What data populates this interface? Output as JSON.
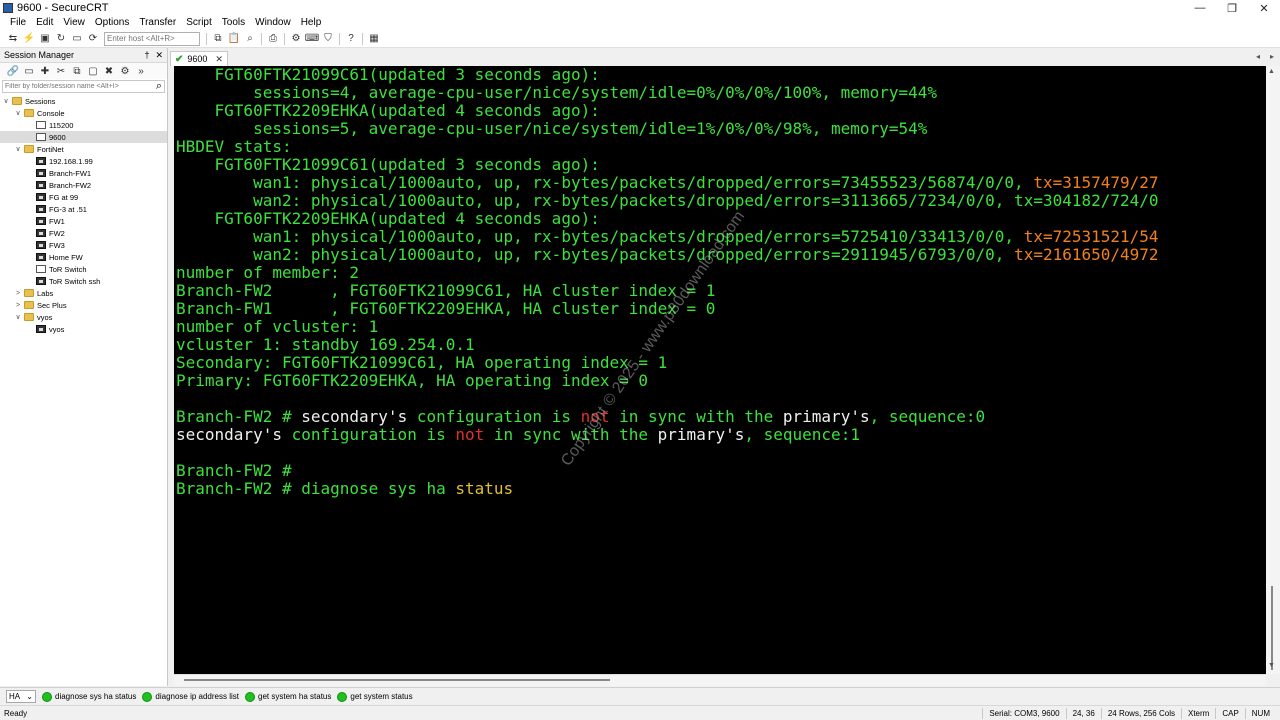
{
  "window": {
    "title": "9600 - SecureCRT",
    "controls": [
      "—",
      "❐",
      "✕"
    ]
  },
  "menu": [
    "File",
    "Edit",
    "View",
    "Options",
    "Transfer",
    "Script",
    "Tools",
    "Window",
    "Help"
  ],
  "toolbar": {
    "host_placeholder": "Enter host <Alt+R>"
  },
  "session_manager": {
    "title": "Session Manager",
    "pin": "†",
    "close": "✕",
    "filter_placeholder": "Filter by folder/session name <Alt+I>",
    "tree": [
      {
        "label": "Sessions",
        "level": 0,
        "type": "folder",
        "toggle": "∨"
      },
      {
        "label": "Console",
        "level": 1,
        "type": "folder",
        "toggle": "∨"
      },
      {
        "label": "115200",
        "level": 2,
        "type": "console"
      },
      {
        "label": "9600",
        "level": 2,
        "type": "console",
        "selected": true
      },
      {
        "label": "FortiNet",
        "level": 1,
        "type": "folder",
        "toggle": "∨"
      },
      {
        "label": "192.168.1.99",
        "level": 2,
        "type": "session"
      },
      {
        "label": "Branch-FW1",
        "level": 2,
        "type": "session"
      },
      {
        "label": "Branch-FW2",
        "level": 2,
        "type": "session"
      },
      {
        "label": "FG at 99",
        "level": 2,
        "type": "session"
      },
      {
        "label": "FG-3 at .51",
        "level": 2,
        "type": "session"
      },
      {
        "label": "FW1",
        "level": 2,
        "type": "session"
      },
      {
        "label": "FW2",
        "level": 2,
        "type": "session"
      },
      {
        "label": "FW3",
        "level": 2,
        "type": "session"
      },
      {
        "label": "Home FW",
        "level": 2,
        "type": "session"
      },
      {
        "label": "ToR Switch",
        "level": 2,
        "type": "console"
      },
      {
        "label": "ToR Switch ssh",
        "level": 2,
        "type": "session"
      },
      {
        "label": "Labs",
        "level": 1,
        "type": "folder",
        "toggle": ">"
      },
      {
        "label": "Sec Plus",
        "level": 1,
        "type": "folder",
        "toggle": ">"
      },
      {
        "label": "vyos",
        "level": 1,
        "type": "folder",
        "toggle": "∨"
      },
      {
        "label": "vyos",
        "level": 2,
        "type": "session"
      }
    ]
  },
  "tabs": [
    {
      "label": "9600",
      "close": "✕"
    }
  ],
  "terminal": {
    "lines": [
      [
        [
          "g",
          "    FGT60FTK21099C61(updated 3 seconds ago):"
        ]
      ],
      [
        [
          "g",
          "        sessions=4, average-cpu-user/nice/system/idle=0%/0%/0%/100%, memory=44%"
        ]
      ],
      [
        [
          "g",
          "    FGT60FTK2209EHKA(updated 4 seconds ago):"
        ]
      ],
      [
        [
          "g",
          "        sessions=5, average-cpu-user/nice/system/idle=1%/0%/0%/98%, memory=54%"
        ]
      ],
      [
        [
          "g",
          "HBDEV stats:"
        ]
      ],
      [
        [
          "g",
          "    FGT60FTK21099C61(updated 3 seconds ago):"
        ]
      ],
      [
        [
          "g",
          "        wan1: physical/1000auto, up, rx-bytes/packets/dropped/errors=73455523/56874/0/0, "
        ],
        [
          "o",
          "tx=3157479/27"
        ]
      ],
      [
        [
          "g",
          "        wan2: physical/1000auto, up, rx-bytes/packets/dropped/errors=3113665/7234/0/0, tx=304182/724/0"
        ]
      ],
      [
        [
          "g",
          "    FGT60FTK2209EHKA(updated 4 seconds ago):"
        ]
      ],
      [
        [
          "g",
          "        wan1: physical/1000auto, up, rx-bytes/packets/dropped/errors=5725410/33413/0/0, "
        ],
        [
          "o",
          "tx=72531521/54"
        ]
      ],
      [
        [
          "g",
          "        wan2: physical/1000auto, up, rx-bytes/packets/dropped/errors=2911945/6793/0/0, "
        ],
        [
          "o",
          "tx=2161650/4972"
        ]
      ],
      [
        [
          "g",
          "number of member: 2"
        ]
      ],
      [
        [
          "g",
          "Branch-FW2      , FGT60FTK21099C61, HA cluster index = 1"
        ]
      ],
      [
        [
          "g",
          "Branch-FW1      , FGT60FTK2209EHKA, HA cluster index = 0"
        ]
      ],
      [
        [
          "g",
          "number of vcluster: 1"
        ]
      ],
      [
        [
          "g",
          "vcluster 1: standby 169.254.0.1"
        ]
      ],
      [
        [
          "g",
          "Secondary: FGT60FTK21099C61, HA operating index = 1"
        ]
      ],
      [
        [
          "g",
          "Primary: FGT60FTK2209EHKA, HA operating index = 0"
        ]
      ],
      [
        [
          "g",
          ""
        ]
      ],
      [
        [
          "g",
          "Branch-FW2 # "
        ],
        [
          "w",
          "secondary's "
        ],
        [
          "g",
          "configuration is "
        ],
        [
          "r",
          "not"
        ],
        [
          "g",
          " in sync with the "
        ],
        [
          "w",
          "primary's"
        ],
        [
          "g",
          ", sequence:0"
        ]
      ],
      [
        [
          "w",
          "secondary's "
        ],
        [
          "g",
          "configuration is "
        ],
        [
          "r",
          "not"
        ],
        [
          "g",
          " in sync with the "
        ],
        [
          "w",
          "primary's"
        ],
        [
          "g",
          ", sequence:1"
        ]
      ],
      [
        [
          "g",
          ""
        ]
      ],
      [
        [
          "g",
          "Branch-FW2 #"
        ]
      ],
      [
        [
          "g",
          "Branch-FW2 # diagnose sys ha "
        ],
        [
          "y",
          "status"
        ]
      ]
    ]
  },
  "command_bar": {
    "select": "HA",
    "buttons": [
      "diagnose sys ha status",
      "diagnose ip address list",
      "get system ha status",
      "get system status"
    ]
  },
  "status": {
    "ready": "Ready",
    "serial": "Serial: COM3, 9600",
    "cursor": "24, 36",
    "size": "24 Rows, 256 Cols",
    "term": "Xterm",
    "caps": "CAP",
    "num": "NUM"
  }
}
